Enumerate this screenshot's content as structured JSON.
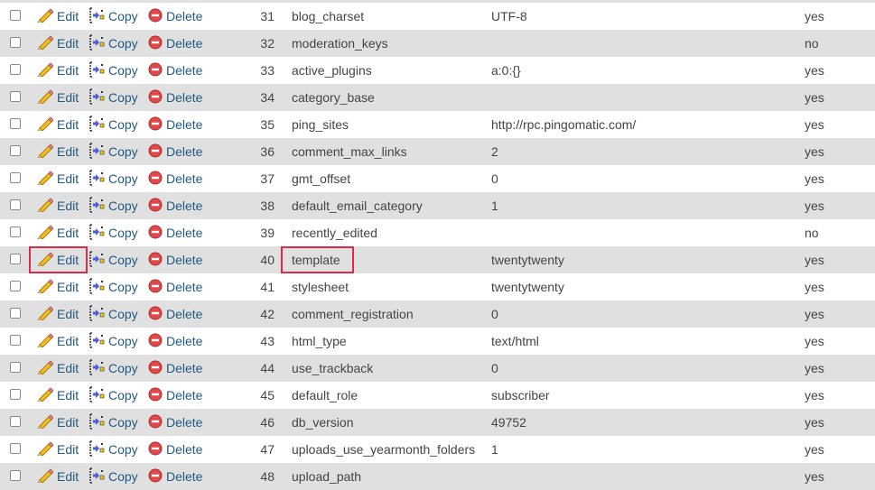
{
  "actions": {
    "edit_label": "Edit",
    "copy_label": "Copy",
    "delete_label": "Delete",
    "edit_icon": "pencil-icon",
    "copy_icon": "copy-icon",
    "delete_icon": "delete-icon"
  },
  "highlight_color": "#e0284a",
  "link_color": "#235a81",
  "highlighted_row": "40",
  "rows": [
    {
      "id": "31",
      "option_name": "blog_charset",
      "option_value": "UTF-8",
      "autoload": "yes"
    },
    {
      "id": "32",
      "option_name": "moderation_keys",
      "option_value": "",
      "autoload": "no"
    },
    {
      "id": "33",
      "option_name": "active_plugins",
      "option_value": "a:0:{}",
      "autoload": "yes"
    },
    {
      "id": "34",
      "option_name": "category_base",
      "option_value": "",
      "autoload": "yes"
    },
    {
      "id": "35",
      "option_name": "ping_sites",
      "option_value": "http://rpc.pingomatic.com/",
      "autoload": "yes"
    },
    {
      "id": "36",
      "option_name": "comment_max_links",
      "option_value": "2",
      "autoload": "yes"
    },
    {
      "id": "37",
      "option_name": "gmt_offset",
      "option_value": "0",
      "autoload": "yes"
    },
    {
      "id": "38",
      "option_name": "default_email_category",
      "option_value": "1",
      "autoload": "yes"
    },
    {
      "id": "39",
      "option_name": "recently_edited",
      "option_value": "",
      "autoload": "no"
    },
    {
      "id": "40",
      "option_name": "template",
      "option_value": "twentytwenty",
      "autoload": "yes"
    },
    {
      "id": "41",
      "option_name": "stylesheet",
      "option_value": "twentytwenty",
      "autoload": "yes"
    },
    {
      "id": "42",
      "option_name": "comment_registration",
      "option_value": "0",
      "autoload": "yes"
    },
    {
      "id": "43",
      "option_name": "html_type",
      "option_value": "text/html",
      "autoload": "yes"
    },
    {
      "id": "44",
      "option_name": "use_trackback",
      "option_value": "0",
      "autoload": "yes"
    },
    {
      "id": "45",
      "option_name": "default_role",
      "option_value": "subscriber",
      "autoload": "yes"
    },
    {
      "id": "46",
      "option_name": "db_version",
      "option_value": "49752",
      "autoload": "yes"
    },
    {
      "id": "47",
      "option_name": "uploads_use_yearmonth_folders",
      "option_value": "1",
      "autoload": "yes"
    },
    {
      "id": "48",
      "option_name": "upload_path",
      "option_value": "",
      "autoload": "yes"
    }
  ]
}
